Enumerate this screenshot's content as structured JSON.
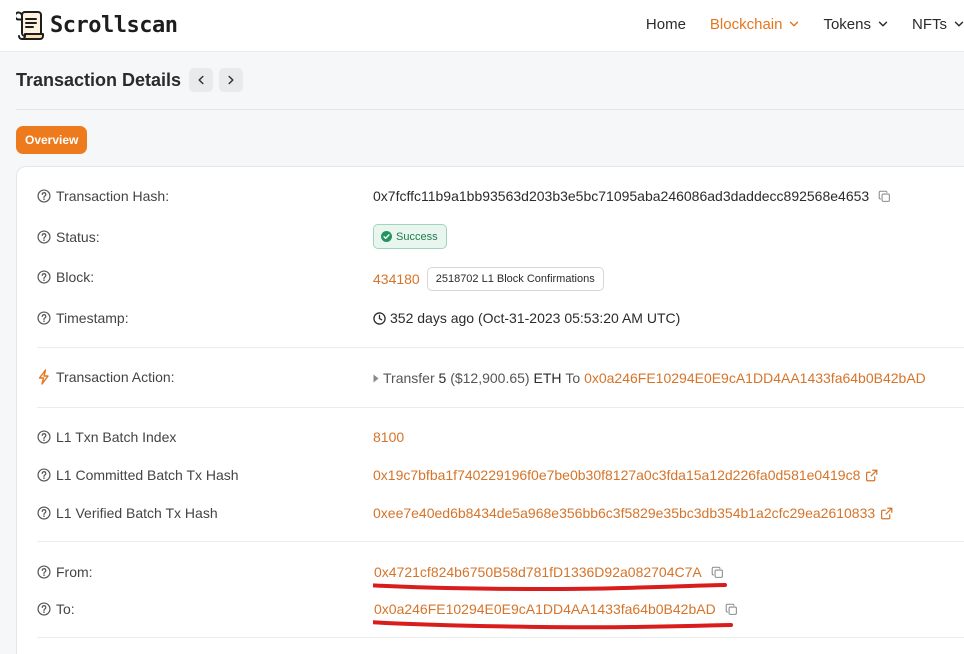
{
  "header": {
    "brand": "Scrollscan",
    "nav": [
      {
        "label": "Home"
      },
      {
        "label": "Blockchain"
      },
      {
        "label": "Tokens"
      },
      {
        "label": "NFTs"
      }
    ],
    "accent_color": "#e2771f"
  },
  "page": {
    "title": "Transaction Details",
    "tab_overview": "Overview"
  },
  "details": {
    "tx_hash": {
      "label": "Transaction Hash:",
      "value": "0x7fcffc11b9a1bb93563d203b3e5bc71095aba246086ad3daddecc892568e4653"
    },
    "status": {
      "label": "Status:",
      "value": "Success"
    },
    "block": {
      "label": "Block:",
      "value": "434180",
      "confirmations": "2518702 L1 Block Confirmations"
    },
    "timestamp": {
      "label": "Timestamp:",
      "value": "352 days ago (Oct-31-2023 05:53:20 AM UTC)"
    },
    "action": {
      "label": "Transaction Action:",
      "verb": "Transfer",
      "amount": "5",
      "usd": "($12,900.65)",
      "token": "ETH",
      "to_word": "To",
      "to_address": "0x0a246FE10294E0E9cA1DD4AA1433fa64b0B42bAD"
    },
    "batch_index": {
      "label": "L1 Txn Batch Index",
      "value": "8100"
    },
    "committed_hash": {
      "label": "L1 Committed Batch Tx Hash",
      "value": "0x19c7bfba1f740229196f0e7be0b30f8127a0c3fda15a12d226fa0d581e0419c8"
    },
    "verified_hash": {
      "label": "L1 Verified Batch Tx Hash",
      "value": "0xee7e40ed6b8434de5a968e356bb6c3f5829e35bc3db354b1a2cfc29ea2610833"
    },
    "from": {
      "label": "From:",
      "value": "0x4721cf824b6750B58d781fD1336D92a082704C7A"
    },
    "to": {
      "label": "To:",
      "value": "0x0a246FE10294E0E9cA1DD4AA1433fa64b0B42bAD"
    }
  },
  "icons": {
    "help": "question-circle-icon",
    "copy": "copy-icon",
    "external": "external-link-icon",
    "clock": "clock-icon",
    "success": "check-circle-icon",
    "action": "lightning-icon"
  },
  "colors": {
    "link": "#d5742a",
    "success_bg": "#e8f6ef",
    "success_text": "#1f7a4f",
    "tab_bg": "#ee7a1e",
    "annotation": "#d91c1c"
  }
}
